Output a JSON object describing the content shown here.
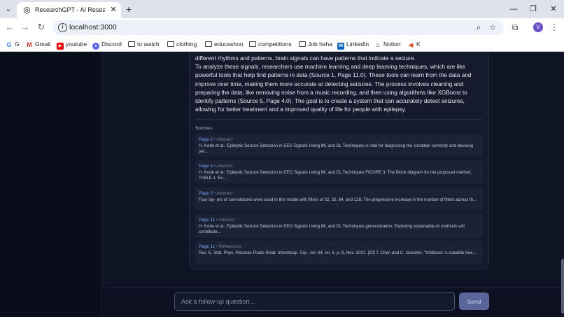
{
  "browser": {
    "tab_title": "ResearchGPT - AI Research Pap",
    "url": "localhost:3000",
    "profile_initial": "V",
    "bookmarks": [
      "G",
      "Gmail",
      "youtube",
      "Discord",
      "to watch",
      "clothing",
      "educashon",
      "competitions",
      "Job haha",
      "LinkedIn",
      "Notion",
      "K"
    ]
  },
  "answer": {
    "paragraphs": [
      "different rhythms and patterns, brain signals can have patterns that indicate a seizure.",
      "To analyze these signals, researchers use machine learning and deep learning techniques, which are like powerful tools that help find patterns in data (Source 1, Page 11.0). These tools can learn from the data and improve over time, making them more accurate at detecting seizures. The process involves cleaning and preparing the data, like removing noise from a music recording, and then using algorithms like XGBoost to identify patterns (Source 5, Page 4.0). The goal is to create a system that can accurately detect seizures, allowing for better treatment and a improved quality of life for people with epilepsy."
    ]
  },
  "sources": {
    "label": "Sources:",
    "separator": "•",
    "items": [
      {
        "page": "Page 2",
        "section": "Abstract",
        "text": "H. Kode et al.: Epileptic Seizure Detection in EEG Signals Using ML and DL Techniques is vital for diagnosing the condition correctly and devising per..."
      },
      {
        "page": "Page 4",
        "section": "Abstract",
        "text": "H. Kode et al.: Epileptic Seizure Detection in EEG Signals Using ML and DL Techniques FIGURE 3. The Block diagram for the proposed method. TABLE 1. Ex..."
      },
      {
        "page": "Page 5",
        "section": "Abstract",
        "text": "Four lay- ers of convolutions were used in this model with filters of 32, 32, 64, and 128. The progressive increase in the number of filters across th..."
      },
      {
        "page": "Page 11",
        "section": "Abstract",
        "text": "H. Kode et al.: Epileptic Seizure Detection in EEG Signals Using ML and DL Techniques generalization. Exploring explainable AI methods will contribute..."
      },
      {
        "page": "Page 11",
        "section": "References",
        "text": "Rev. E, Stat. Phys. Plasmas Fluids Relat. Interdiscip. Top., vol. 64, no. 6, p. 8, Nov. 2001. [20] T. Chen and C. Guestrin, \"XGBoost: A scalable tree..."
      }
    ]
  },
  "followup": {
    "placeholder": "Ask a follow-up question...",
    "send_label": "Send"
  }
}
